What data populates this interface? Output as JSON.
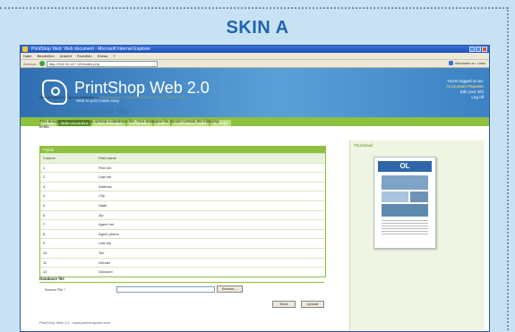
{
  "skin_title": "SKIN A",
  "browser": {
    "title": "PrintShop Web: Web document - Microsoft Internet Explorer",
    "menu": [
      "Datei",
      "Bearbeiten",
      "Ansicht",
      "Favoriten",
      "Extras",
      "?"
    ],
    "address_label": "Adresse",
    "url": "http://216.94.147.120/index.php",
    "go_label": "Wechseln zu",
    "links_label": "Links"
  },
  "app": {
    "brand": "PrintShop Web 2.0",
    "tagline": "Web-to-print made easy",
    "login_line1": "You're logged on as:",
    "login_user": "Accountant Paquette",
    "login_line2": "Edit your info",
    "login_line3": "Log off"
  },
  "nav_tabs": [
    "Home",
    "New document",
    "Order Manager",
    "Companies",
    "Users",
    "Publication Types",
    "Settings"
  ],
  "breadcrumb": {
    "active": "New document > Upload Database >",
    "rest": "Edit Template > Field Definitions > Proof > Place Order"
  },
  "page": {
    "title": "Upload database file",
    "intro": "This document requires you to upload a database file. Your database file should contain the following fields:"
  },
  "fields_table": {
    "caption": "Fields",
    "headers": [
      "Column",
      "Field name"
    ],
    "rows": [
      [
        "1",
        "First nm"
      ],
      [
        "2",
        "Last nm"
      ],
      [
        "3",
        "Address"
      ],
      [
        "4",
        "City"
      ],
      [
        "5",
        "State"
      ],
      [
        "6",
        "Zip"
      ],
      [
        "7",
        "Agent nm"
      ],
      [
        "8",
        "Agent phone"
      ],
      [
        "9",
        "Last trip"
      ],
      [
        "10",
        "Tier"
      ],
      [
        "11",
        "Gender"
      ],
      [
        "12",
        "Discount"
      ]
    ]
  },
  "database_file": {
    "section": "Database file",
    "source_label": "Source File *",
    "browse_label": "Browse..."
  },
  "buttons": {
    "back": "Back",
    "upload": "Upload"
  },
  "footer": "PrintShop Web 2.0 - www.printshopweb.com",
  "sidebar": {
    "label": "Thumbnail",
    "mast": "OL"
  }
}
